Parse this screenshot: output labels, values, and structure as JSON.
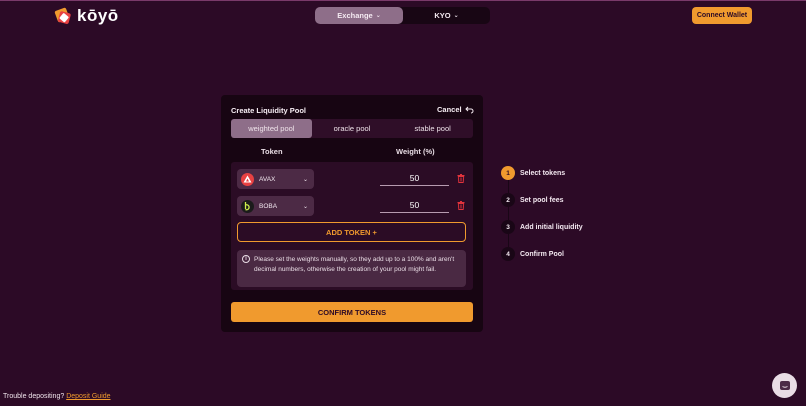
{
  "app": {
    "logo_text": "kōyō"
  },
  "nav": {
    "exchange_label": "Exchange",
    "kyo_label": "KYO",
    "connect_label": "Connect Wallet"
  },
  "panel": {
    "title": "Create Liquidity Pool",
    "cancel_label": "Cancel",
    "tabs": [
      {
        "label": "weighted pool",
        "active": true
      },
      {
        "label": "oracle pool",
        "active": false
      },
      {
        "label": "stable pool",
        "active": false
      }
    ],
    "col_token": "Token",
    "col_weight": "Weight (%)",
    "tokens": [
      {
        "symbol": "AVAX",
        "weight": "50",
        "icon": "avax-icon",
        "color": "#e84142"
      },
      {
        "symbol": "BOBA",
        "weight": "50",
        "icon": "boba-icon",
        "color": "#1b1b1b"
      }
    ],
    "add_token_label": "ADD TOKEN +",
    "notice": "Please set the weights manually, so they add up to a 100% and aren't decimal numbers, otherwise the creation of your pool might fail.",
    "confirm_label": "CONFIRM TOKENS"
  },
  "steps": [
    {
      "num": "1",
      "label": "Select tokens",
      "active": true
    },
    {
      "num": "2",
      "label": "Set pool fees",
      "active": false
    },
    {
      "num": "3",
      "label": "Add initial liquidity",
      "active": false
    },
    {
      "num": "4",
      "label": "Confirm Pool",
      "active": false
    }
  ],
  "footer": {
    "text": "Trouble depositing?",
    "link": "Deposit Guide"
  },
  "colors": {
    "background": "#2c0a26",
    "accent": "#f09a2e",
    "panel": "#170512",
    "active_tab": "#8e6e89",
    "danger": "#e0333c"
  }
}
